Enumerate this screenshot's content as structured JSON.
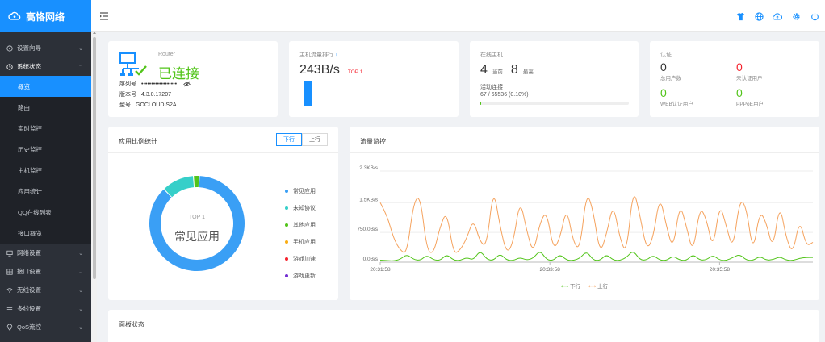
{
  "brand": {
    "name": "高恪网络"
  },
  "sidebar": {
    "groups": [
      {
        "label": "设置向导",
        "icon": "compass-icon",
        "open": false
      },
      {
        "label": "系统状态",
        "icon": "clock-icon",
        "open": true,
        "items": [
          {
            "label": "概览",
            "active": true
          },
          {
            "label": "路由",
            "active": false
          },
          {
            "label": "实时监控",
            "active": false
          },
          {
            "label": "历史监控",
            "active": false
          },
          {
            "label": "主机监控",
            "active": false
          },
          {
            "label": "应用统计",
            "active": false
          },
          {
            "label": "QQ在线列表",
            "active": false
          },
          {
            "label": "接口概览",
            "active": false
          }
        ]
      },
      {
        "label": "网络设置",
        "icon": "monitor-icon",
        "open": false
      },
      {
        "label": "接口设置",
        "icon": "grid-icon",
        "open": false
      },
      {
        "label": "无线设置",
        "icon": "wifi-icon",
        "open": false
      },
      {
        "label": "多线设置",
        "icon": "layers-icon",
        "open": false
      },
      {
        "label": "QoS流控",
        "icon": "pin-icon",
        "open": false
      }
    ]
  },
  "header": {
    "icons": [
      "shirt-icon",
      "globe-icon",
      "cloud-upload-icon",
      "gear-icon",
      "power-icon"
    ]
  },
  "router_card": {
    "title": "Router",
    "status": "已连接",
    "serial_label": "序列号",
    "serial_value": "••••••••••••••••••",
    "version_label": "版本号",
    "version_value": "4.3.0.17207",
    "model_label": "型号",
    "model_value": "GOCLOUD S2A"
  },
  "traffic_card": {
    "title": "主机流量排行",
    "sort_arrow": "↓",
    "value": "243B/s",
    "badge": "TOP 1"
  },
  "hosts_card": {
    "title": "在线主机",
    "current_value": "4",
    "current_label": "当前",
    "max_value": "8",
    "max_label": "最高",
    "conn_label": "活动连接",
    "conn_value": "67 / 65536 (0.10%)",
    "conn_fraction": 0.001
  },
  "auth_card": {
    "title": "认证",
    "total_value": "0",
    "total_label": "总用户数",
    "unauth_value": "0",
    "unauth_label": "未认证用户",
    "web_value": "0",
    "web_label": "WEB认证用户",
    "pppoe_value": "0",
    "pppoe_label": "PPPoE用户"
  },
  "app_stats": {
    "title": "应用比例统计",
    "tab_down": "下行",
    "tab_up": "上行",
    "center_top": "TOP 1",
    "center_label": "常见应用",
    "legend": [
      {
        "label": "常见应用",
        "color": "#3a9ff5",
        "share": 0.87
      },
      {
        "label": "未知协议",
        "color": "#36cfc9",
        "share": 0.11
      },
      {
        "label": "其他应用",
        "color": "#52c41a",
        "share": 0.02
      },
      {
        "label": "手机应用",
        "color": "#faad14",
        "share": 0
      },
      {
        "label": "游戏加速",
        "color": "#f5222d",
        "share": 0
      },
      {
        "label": "游戏更新",
        "color": "#722ed1",
        "share": 0
      }
    ]
  },
  "traffic_monitor": {
    "title": "流量监控",
    "legend_down": "下行",
    "legend_up": "上行"
  },
  "panel_status": {
    "title": "面板状态"
  },
  "chart_data": {
    "type": "line",
    "title": "流量监控",
    "y_ticks": [
      "0.0B/s",
      "750.0B/s",
      "1.5KB/s",
      "2.3KB/s"
    ],
    "ylim": [
      0,
      2.3
    ],
    "y_unit": "KB/s",
    "x_ticks": [
      "20:31:58",
      "20:33:58",
      "20:35:58"
    ],
    "x_range_minutes": [
      0,
      5.1
    ],
    "grid": true,
    "legend_placement": "bottom",
    "series": [
      {
        "name": "上行",
        "color": "#f5a25d",
        "values": [
          1.5,
          1.2,
          0.6,
          0.3,
          0.2,
          1.5,
          1.7,
          0.3,
          0.2,
          0.9,
          1.3,
          0.2,
          0.3,
          0.6,
          1.1,
          0.5,
          0.4,
          1.9,
          0.9,
          0.2,
          0.5,
          1.6,
          0.8,
          0.2,
          1.0,
          1.3,
          0.3,
          0.6,
          1.4,
          0.5,
          0.3,
          1.8,
          1.3,
          0.2,
          0.7,
          1.5,
          0.6,
          0.2,
          1.9,
          1.2,
          0.3,
          0.6,
          1.7,
          0.9,
          0.3,
          1.5,
          0.9,
          0.2,
          1.4,
          1.1,
          0.3,
          1.5,
          0.9,
          0.3,
          1.6,
          1.4,
          0.2,
          1.3,
          1.0,
          0.3,
          1.5,
          0.6,
          0.2,
          1.1,
          0.4,
          0.5
        ]
      },
      {
        "name": "下行",
        "color": "#52c41a",
        "values": [
          0.05,
          0.04,
          0.03,
          0.07,
          0.2,
          0.07,
          0.04,
          0.18,
          0.06,
          0.04,
          0.2,
          0.05,
          0.04,
          0.12,
          0.05,
          0.3,
          0.07,
          0.04,
          0.22,
          0.05,
          0.04,
          0.12,
          0.05,
          0.1,
          0.3,
          0.06,
          0.04,
          0.2,
          0.05,
          0.04,
          0.1,
          0.28,
          0.05,
          0.04,
          0.2,
          0.05,
          0.04,
          0.12,
          0.3,
          0.06,
          0.05,
          0.18,
          0.05,
          0.04,
          0.16,
          0.05,
          0.04,
          0.2,
          0.05,
          0.06,
          0.18,
          0.05,
          0.04,
          0.12,
          0.2,
          0.05,
          0.04,
          0.15,
          0.05,
          0.06,
          0.14,
          0.05,
          0.04,
          0.1,
          0.12,
          0.12
        ]
      }
    ]
  }
}
